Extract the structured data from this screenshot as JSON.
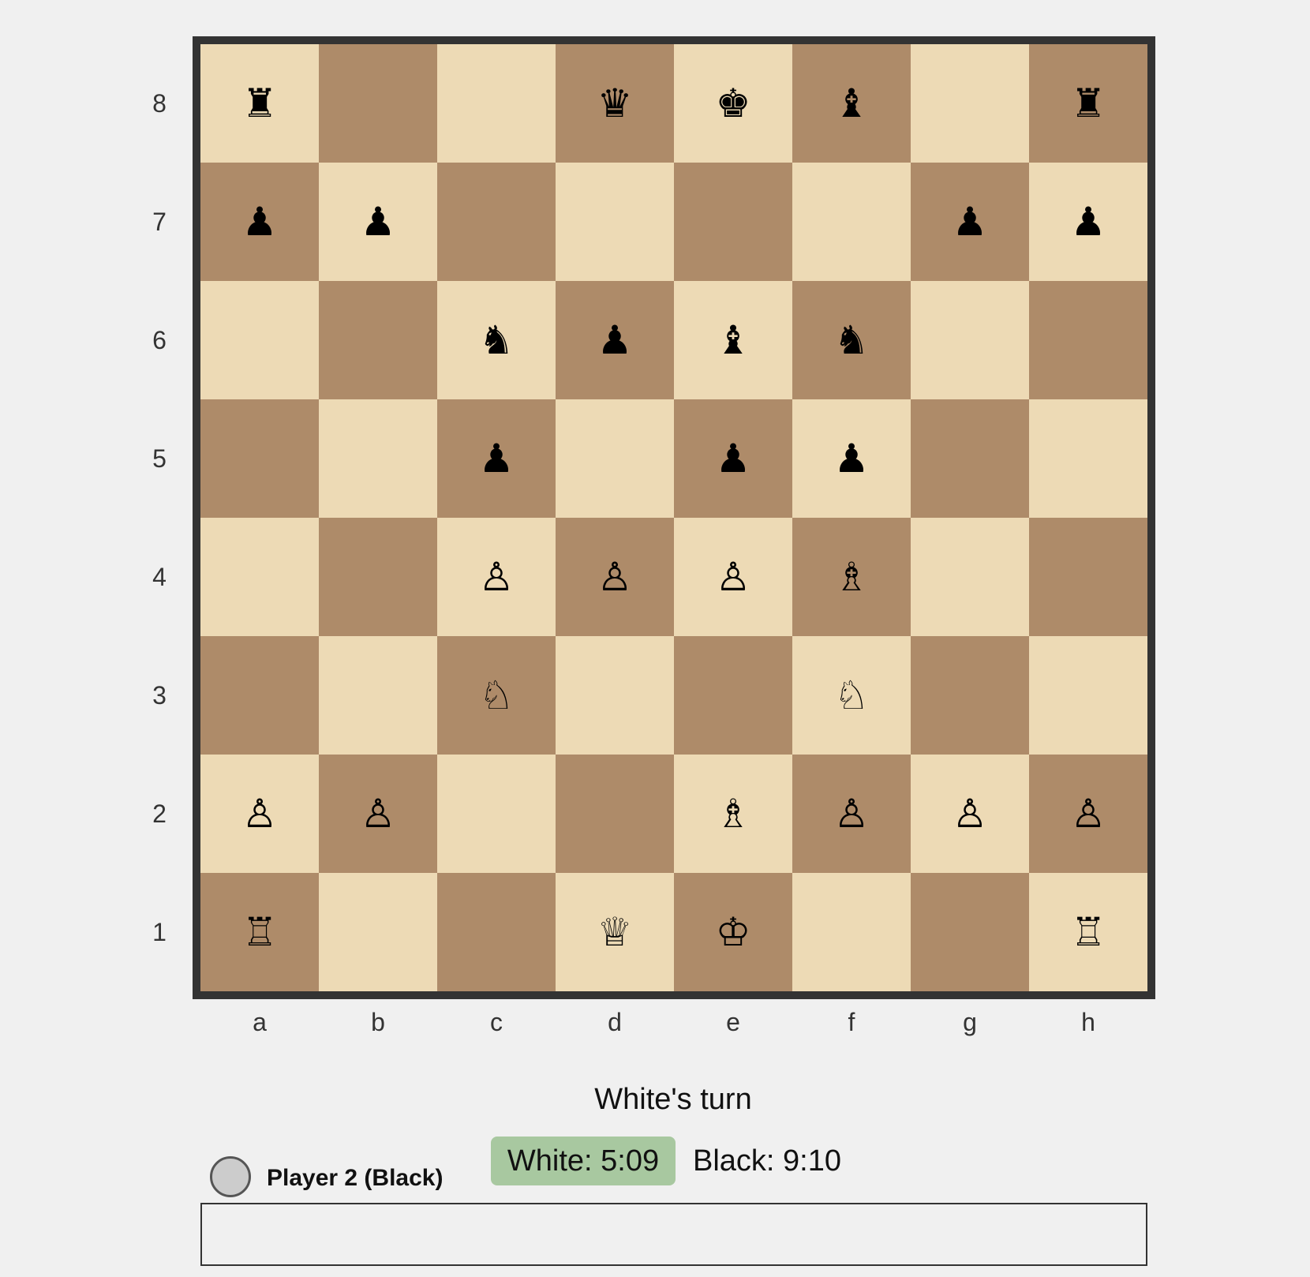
{
  "board": {
    "ranks": [
      "8",
      "7",
      "6",
      "5",
      "4",
      "3",
      "2",
      "1"
    ],
    "files": [
      "a",
      "b",
      "c",
      "d",
      "e",
      "f",
      "g",
      "h"
    ],
    "position": [
      [
        "♜",
        "",
        "",
        "♛",
        "♚",
        "♝",
        "",
        "♜"
      ],
      [
        "♟",
        "♟",
        "",
        "",
        "",
        "",
        "♟",
        "♟"
      ],
      [
        "",
        "",
        "♞",
        "♟",
        "♝",
        "♞",
        "",
        ""
      ],
      [
        "",
        "",
        "♟",
        "",
        "♟",
        "♟",
        "",
        ""
      ],
      [
        "",
        "",
        "♙",
        "♙",
        "♙",
        "♗",
        "",
        ""
      ],
      [
        "",
        "",
        "♘",
        "",
        "",
        "♘",
        "",
        ""
      ],
      [
        "♙",
        "♙",
        "",
        "",
        "♗",
        "♙",
        "♙",
        "♙"
      ],
      [
        "♖",
        "",
        "",
        "♕",
        "♔",
        "",
        "",
        "♖"
      ]
    ],
    "piece_names": {
      "♜": "black-rook",
      "♛": "black-queen",
      "♚": "black-king",
      "♝": "black-bishop",
      "♞": "black-knight",
      "♟": "black-pawn",
      "♖": "white-rook",
      "♕": "white-queen",
      "♔": "white-king",
      "♗": "white-bishop",
      "♘": "white-knight",
      "♙": "white-pawn"
    },
    "colors": {
      "light_square": "#eddab5",
      "dark_square": "#ae8b69",
      "frame": "#333333"
    }
  },
  "status": {
    "turn": "White's turn"
  },
  "player": {
    "name": "Player 2 (Black)"
  },
  "clocks": {
    "white": "White: 5:09",
    "black": "Black: 9:10",
    "active_color": "#a8c8a0"
  },
  "move_input": {
    "value": "",
    "placeholder": ""
  }
}
